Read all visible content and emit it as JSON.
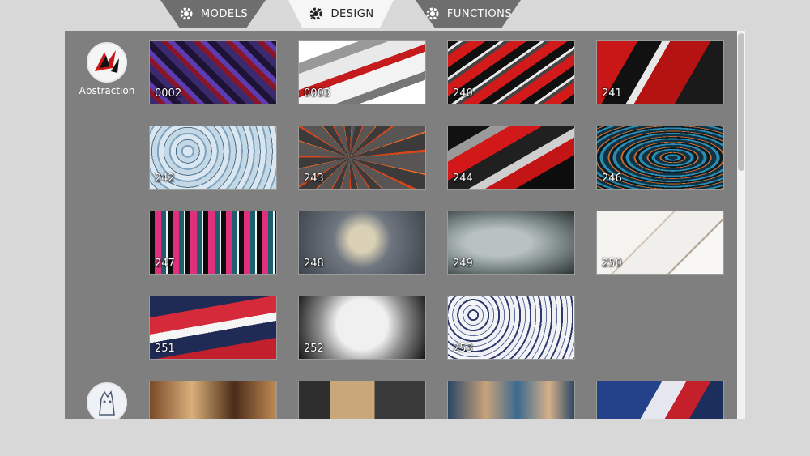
{
  "tabs": [
    {
      "label": "MODELS",
      "icon": "gear-icon",
      "active": false
    },
    {
      "label": "DESIGN",
      "icon": "design-gear-icon",
      "active": true
    },
    {
      "label": "FUNCTIONS",
      "icon": "gear-icon",
      "active": false
    }
  ],
  "categories": [
    {
      "label": "Abstraction",
      "icon": "abstraction-thumbnail"
    },
    {
      "label": "",
      "icon": "wolf-thumbnail"
    }
  ],
  "designs": [
    {
      "number": "0002",
      "texture": "purple geometric"
    },
    {
      "number": "0003",
      "texture": "silver red shards"
    },
    {
      "number": "240",
      "texture": "red black stripes"
    },
    {
      "number": "241",
      "texture": "red black splash"
    },
    {
      "number": "242",
      "texture": "ice blue swirl"
    },
    {
      "number": "243",
      "texture": "lava cracks"
    },
    {
      "number": "244",
      "texture": "red grey arrows"
    },
    {
      "number": "246",
      "texture": "blue orange marble"
    },
    {
      "number": "247",
      "texture": "pink teal graffiti"
    },
    {
      "number": "248",
      "texture": "cracked earth"
    },
    {
      "number": "249",
      "texture": "grey grunge"
    },
    {
      "number": "250",
      "texture": "white marble"
    },
    {
      "number": "251",
      "texture": "navy red flag"
    },
    {
      "number": "252",
      "texture": "black white grunge"
    },
    {
      "number": "253",
      "texture": "blue floral"
    },
    {
      "number": "",
      "texture": "bear"
    },
    {
      "number": "",
      "texture": "mech dark"
    },
    {
      "number": "",
      "texture": "mech blue"
    },
    {
      "number": "",
      "texture": "wolf"
    }
  ]
}
